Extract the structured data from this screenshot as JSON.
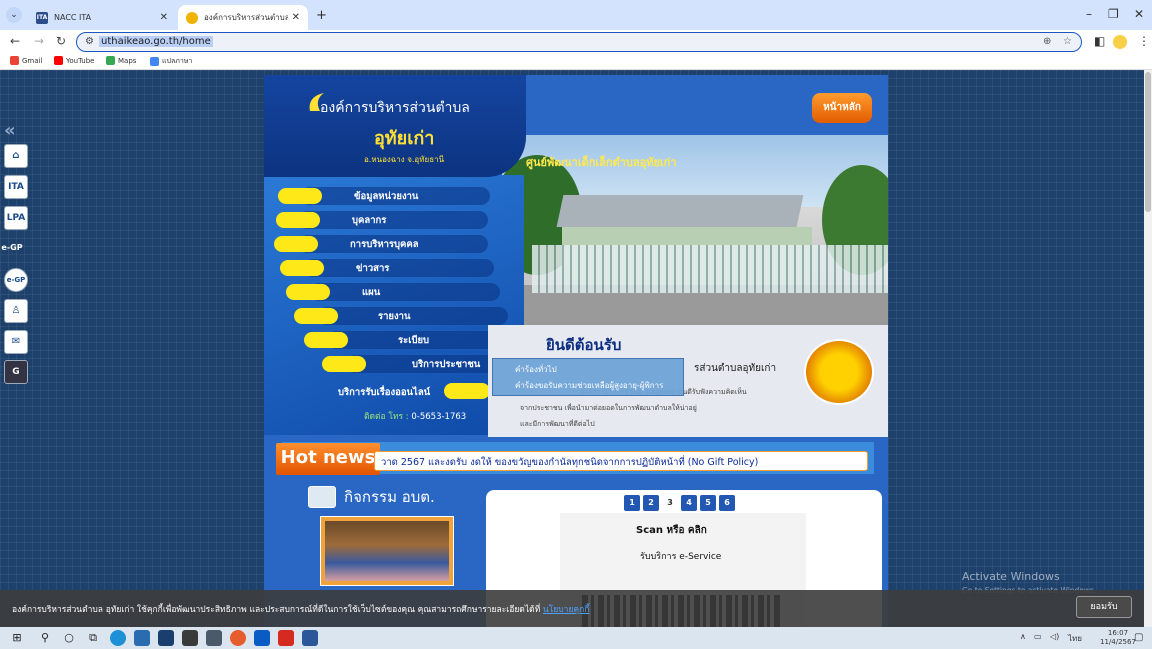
{
  "browser": {
    "tabs": [
      {
        "favicon": "ITA",
        "title": "NACC ITA",
        "active": false
      },
      {
        "favicon": "sunflower-icon",
        "title": "องค์การบริหารส่วนตำบล อุทัยเก่า อ.",
        "active": true
      }
    ],
    "new_tab": "+",
    "url": "uthaikeao.go.th/home",
    "bookmarks": [
      "Gmail",
      "YouTube",
      "Maps",
      "แปลภาษา"
    ]
  },
  "quickbar": {
    "collapse": "«",
    "items": [
      "home-icon",
      "ITA",
      "LPA",
      "e-GP",
      "e-GP",
      "user-icon",
      "mail-icon",
      "translate-icon"
    ]
  },
  "header": {
    "org_name": "องค์การบริหารส่วนตำบล",
    "org_sub": "อุทัยเก่า",
    "district": "อ.หนองฉาง จ.อุทัยธานี",
    "banner_title": "ศูนย์พัฒนาเด็กเล็กตำบลอุทัยเก่า",
    "home_button": "หน้าหลัก"
  },
  "menu": [
    "ข้อมูลหน่วยงาน",
    "บุคลากร",
    "การบริหารบุคคล",
    "ข่าวสาร",
    "แผน",
    "รายงาน",
    "ระเบียบ",
    "บริการประชาชน"
  ],
  "online_service": "บริการรับเรื่องออนไลน์",
  "contact": {
    "label": "ติดต่อ โทร :",
    "phone": "0-5653-1763"
  },
  "dropdown": [
    "คำร้องทั่วไป",
    "คำร้องขอรับความช่วยเหลือผู้สูงอายุ-ผู้พิการ"
  ],
  "welcome": {
    "title": "ยินดีต้อนรับ",
    "line1": "รส่วนตำบลอุทัยเก่า",
    "line2": "องค์การบริหารส่วนตำบลอุทัยเก่ายินดีรับฟังความคิดเห็น",
    "line3": "จากประชาชน เพื่อนำมาต่อยอดในการพัฒนาตำบลให้น่าอยู่",
    "line4": "และมีการพัฒนาที่ดีต่อไป"
  },
  "hotnews": {
    "label": "Hot news",
    "ticker": "วาด 2567 และงดรับ งดให้ ของขวัญของกำนัลทุกชนิดจากการปฏิบัติหน้าที่ (No Gift Policy)"
  },
  "activities": {
    "title": "กิจกรรม อบต."
  },
  "service": {
    "pages": [
      "1",
      "2",
      "3",
      "4",
      "5",
      "6"
    ],
    "current_page": "3",
    "scan_text": "Scan หรือ คลิก",
    "scan_sub": "รับบริการ e-Service"
  },
  "watermark": {
    "line1": "Activate Windows",
    "line2": "Go to Settings to activate Windows."
  },
  "cookie": {
    "text": "องค์การบริหารส่วนตำบล อุทัยเก่า ใช้คุกกี้เพื่อพัฒนาประสิทธิภาพ และประสบการณ์ที่ดีในการใช้เว็บไซต์ของคุณ คุณสามารถศึกษารายละเอียดได้ที่",
    "link": "นโยบายคุกกี้",
    "accept": "ยอมรับ"
  },
  "taskbar": {
    "lang": "ไทย",
    "time": "16:07",
    "date": "11/4/2567"
  },
  "colors": {
    "page_blue": "#2a66c4",
    "menu_pill": "#ffe817",
    "hot_orange": "#e25400",
    "bg_navy": "#1e416b"
  }
}
